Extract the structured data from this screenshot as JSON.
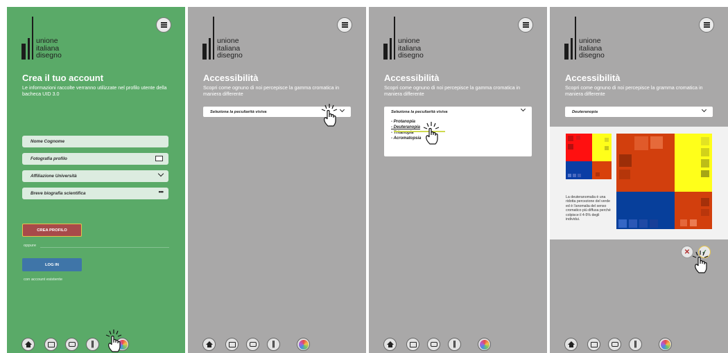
{
  "brand": {
    "line1": "unione",
    "line2": "italiana",
    "line3": "disegno"
  },
  "screen1": {
    "title": "Crea il tuo account",
    "subtitle": "Le informazioni raccolte verranno utilizzate nel profilo utente della bacheca UID 3.0",
    "fields": {
      "name": "Nome Cognome",
      "photo": "Fotografia profilo",
      "affiliation": "Affiliazione Università",
      "bio": "Breve biografia scientifica"
    },
    "create_button": "CREA PROFILO",
    "or_text": "oppure",
    "login_button": "LOG IN",
    "existing_text": "con account esistente"
  },
  "screen2": {
    "title": "Accessibilità",
    "subtitle": "Scopri come ognuno di noi percepisce la gamma cromatica in maniera differente",
    "select_placeholder": "Seleziona la peculiarità visiva"
  },
  "screen3": {
    "title": "Accessibilità",
    "subtitle": "Scopri come ognuno di noi percepisce la gamma cromatica in maniera differente",
    "select_placeholder": "Seleziona la peculiarità visiva",
    "options": [
      "- Protanopia",
      "- Deuteranopia",
      "- Tritanopia",
      "- Acromatopsia"
    ]
  },
  "screen4": {
    "title": "Accessibilità",
    "subtitle": "Scopri come ognuno di noi percepisce la gramma cromatica in maniera differente",
    "selected": "Deuteranopia",
    "description": "La deuteranomalia è una ridotta percezione del verde ed è l'anomalia del senso cromatico più diffusa perché colpisce il 4-5% degli individui."
  },
  "icons": {
    "menu": "menu-icon",
    "home": "home-icon",
    "board": "board-icon",
    "chat": "chat-icon",
    "attach": "attachment-icon",
    "color": "color-wheel-icon",
    "close": "close-icon",
    "confirm": "check-icon",
    "tap": "tap-hand-icon"
  },
  "colors": {
    "green": "#5aaa68",
    "gray": "#a9a8a8",
    "create": "#a84a4a",
    "login": "#3f75a8",
    "red": "#ff1010",
    "orange": "#d8410b",
    "yellow": "#ffff1a",
    "blue": "#073f9b"
  }
}
